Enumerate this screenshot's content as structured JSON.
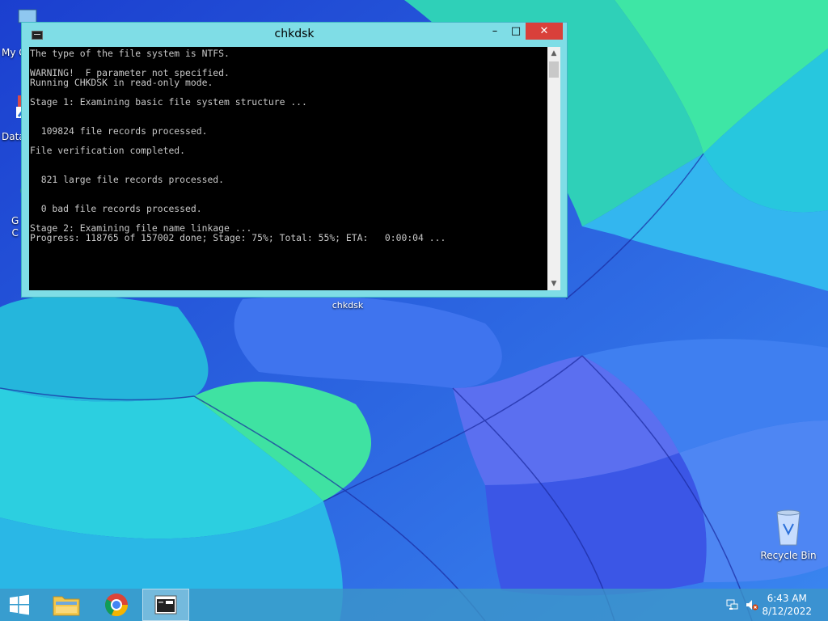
{
  "desktop": {
    "icons": [
      {
        "label": "My C",
        "icon": "computer-icon"
      },
      {
        "label": "Data",
        "icon": "shortcut-icon"
      },
      {
        "label": "G\nC",
        "icon": "chrome-icon"
      },
      {
        "label": "Recycle Bin",
        "icon": "recycle-bin-icon"
      }
    ]
  },
  "window": {
    "title": "chkdsk",
    "minimize_glyph": "–",
    "maximize_glyph": "□",
    "close_glyph": "✕",
    "console_lines": [
      "The type of the file system is NTFS.",
      "",
      "WARNING!  F parameter not specified.",
      "Running CHKDSK in read-only mode.",
      "",
      "Stage 1: Examining basic file system structure ...",
      "",
      "",
      "  109824 file records processed.",
      "",
      "File verification completed.",
      "",
      "",
      "  821 large file records processed.",
      "",
      "",
      "  0 bad file records processed.",
      "",
      "Stage 2: Examining file name linkage ...",
      "Progress: 118765 of 157002 done; Stage: 75%; Total: 55%; ETA:   0:00:04 ..."
    ],
    "taskbar_label": "chkdsk"
  },
  "taskbar": {
    "items": [
      {
        "name": "start",
        "icon": "windows-logo-icon"
      },
      {
        "name": "file-explorer",
        "icon": "folder-icon"
      },
      {
        "name": "chrome",
        "icon": "chrome-icon"
      },
      {
        "name": "console",
        "icon": "console-icon",
        "active": true
      }
    ],
    "tray": {
      "network_icon": "network-icon",
      "volume_icon": "volume-muted-icon"
    },
    "clock": {
      "time": "6:43 AM",
      "date": "8/12/2022"
    }
  },
  "colors": {
    "window_frame": "#7fdde6",
    "close_button": "#d9403a",
    "console_bg": "#000000",
    "console_fg": "#c8c8c8"
  }
}
